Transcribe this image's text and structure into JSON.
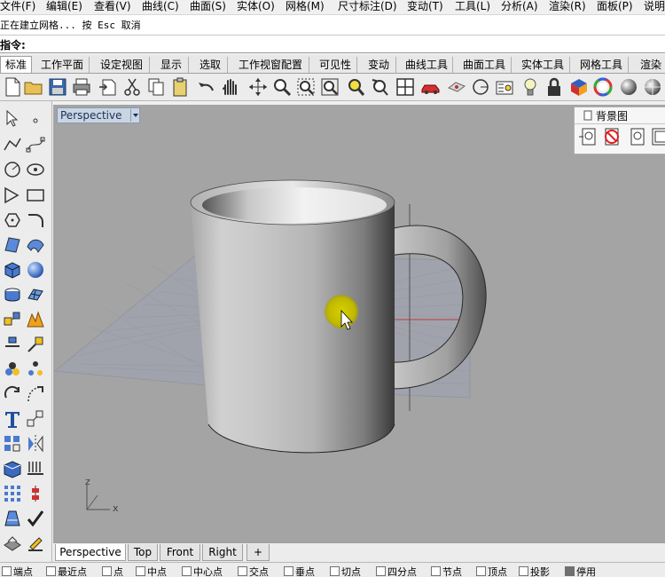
{
  "menu": [
    "文件(F)",
    "编辑(E)",
    "查看(V)",
    "曲线(C)",
    "曲面(S)",
    "实体(O)",
    "网格(M)",
    "尺寸标注(D)",
    "变动(T)",
    "工具(L)",
    "分析(A)",
    "渲染(R)",
    "面板(P)",
    "说明"
  ],
  "command": {
    "history": "正在建立网格... 按 Esc 取消",
    "prompt": "指令:"
  },
  "tabs": [
    "标准",
    "工作平面",
    "设定视图",
    "显示",
    "选取",
    "工作视窗配置",
    "可见性",
    "变动",
    "曲线工具",
    "曲面工具",
    "实体工具",
    "网格工具",
    "渲染"
  ],
  "active_tab": "标准",
  "toolbar_icons": [
    "new-file-icon",
    "open-folder-icon",
    "save-icon",
    "print-icon",
    "import-icon",
    "cut-icon",
    "copy-icon",
    "paste-icon",
    "undo-icon",
    "pan-hand-icon",
    "rotate-view-icon",
    "zoom-icon",
    "zoom-window-icon",
    "zoom-extents-icon",
    "zoom-selected-icon",
    "redo-view-icon",
    "four-viewports-icon",
    "car-icon",
    "plane-icon",
    "circle-tool-icon",
    "layer-icon",
    "light-bulb-icon",
    "lock-icon",
    "render-material-icon",
    "color-wheel-icon",
    "shaded-sphere-icon",
    "render-sphere-icon"
  ],
  "viewport": {
    "title": "Perspective",
    "axis_z": "z",
    "axis_x": "x"
  },
  "background_panel": {
    "title": "背景图"
  },
  "viewport_tabs": [
    "Perspective",
    "Top",
    "Front",
    "Right"
  ],
  "active_viewport_tab": "Perspective",
  "add_tab": "+",
  "snaps": [
    "端点",
    "最近点",
    "点",
    "中点",
    "中心点",
    "交点",
    "垂点",
    "切点",
    "四分点",
    "节点",
    "顶点",
    "投影",
    "停用"
  ],
  "colors": {
    "viewport_bg": "#a4a4a4",
    "grid": "#9296a6",
    "axis_red": "#c43b3b",
    "highlight": "#d8d000"
  }
}
